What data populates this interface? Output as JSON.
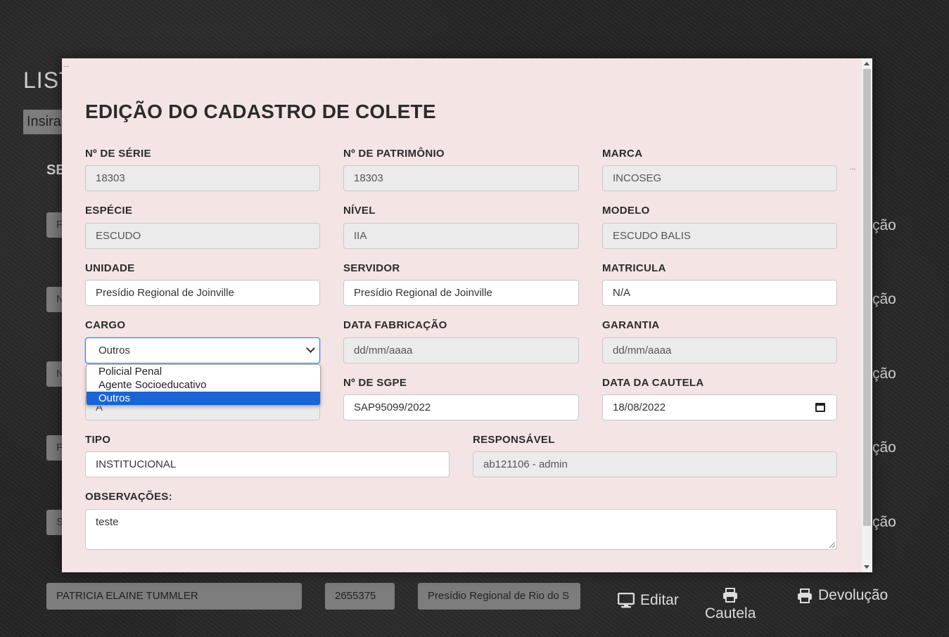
{
  "background": {
    "title_fragment": "LIST",
    "search_placeholder": "Insira",
    "section_fragment": "SE",
    "row_stub_letters": [
      "F",
      "N",
      "N",
      "F",
      "S"
    ],
    "right_column_fragments": [
      "ção",
      "ção",
      "ção",
      "ção",
      "ção"
    ],
    "last_row": {
      "name": "PATRICIA ELAINE TUMMLER",
      "matricula": "2655375",
      "unidade": "Presídio Regional de Rio do S",
      "edit_label": "Editar",
      "cautela_label": "Cautela",
      "devolucao_label": "Devolução"
    }
  },
  "modal": {
    "corner_dots": "...",
    "title": "EDIÇÃO DO CADASTRO DE COLETE",
    "fields": {
      "serie": {
        "label": "Nº DE SÉRIE",
        "value": "18303"
      },
      "patrimonio": {
        "label": "Nº DE PATRIMÔNIO",
        "value": "18303"
      },
      "marca": {
        "label": "MARCA",
        "value": "INCOSEG"
      },
      "especie": {
        "label": "ESPÉCIE",
        "value": "ESCUDO"
      },
      "nivel": {
        "label": "NÍVEL",
        "value": "IIA"
      },
      "modelo": {
        "label": "MODELO",
        "value": "ESCUDO BALIS"
      },
      "unidade": {
        "label": "UNIDADE",
        "value": "Presídio Regional de Joinville"
      },
      "servidor": {
        "label": "SERVIDOR",
        "value": "Presídio Regional de Joinville"
      },
      "matricula": {
        "label": "MATRICULA",
        "value": "N/A"
      },
      "cargo": {
        "label": "CARGO",
        "value": "Outros",
        "options": [
          "Policial Penal",
          "Agente Socioeducativo",
          "Outros"
        ]
      },
      "data_fabricacao": {
        "label": "DATA FABRICAÇÃO",
        "placeholder": "dd/mm/aaaa"
      },
      "garantia": {
        "label": "GARANTIA",
        "placeholder": "dd/mm/aaaa"
      },
      "hidden_field_value": "A",
      "sgpe": {
        "label": "Nº DE SGPE",
        "value": "SAP95099/2022"
      },
      "data_cautela": {
        "label": "DATA DA CAUTELA",
        "value": "18/08/2022"
      },
      "tipo": {
        "label": "TIPO",
        "value": "INSTITUCIONAL"
      },
      "responsavel": {
        "label": "RESPONSÁVEL",
        "value": "ab121106 - admin"
      },
      "observacoes": {
        "label": "OBSERVAÇÕES:",
        "value": "teste"
      }
    }
  }
}
